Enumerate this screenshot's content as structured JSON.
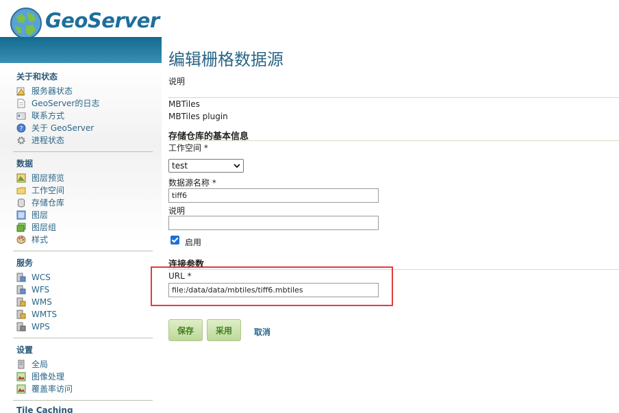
{
  "header": {
    "brand": "GeoServer"
  },
  "page": {
    "title": "编辑栅格数据源",
    "description_label": "说明",
    "type_name": "MBTiles",
    "type_description": "MBTiles plugin",
    "basic_info_heading": "存储仓库的基本信息",
    "workspace_label": "工作空间 *",
    "workspace_value": "test",
    "name_label": "数据源名称 *",
    "name_value": "tiff6",
    "desc_field_label": "说明",
    "desc_field_value": "",
    "enabled_label": "启用",
    "enabled": true,
    "connection_heading": "连接参数",
    "url_label": "URL *",
    "url_value": "file:/data/data/mbtiles/tiff6.mbtiles",
    "save_label": "保存",
    "apply_label": "采用",
    "cancel_label": "取消"
  },
  "sidebar": {
    "sections": [
      {
        "title": "关于和状态",
        "items": [
          "服务器状态",
          "GeoServer的日志",
          "联系方式",
          "关于 GeoServer",
          "进程状态"
        ]
      },
      {
        "title": "数据",
        "items": [
          "图层预览",
          "工作空间",
          "存储仓库",
          "图层",
          "图层组",
          "样式"
        ]
      },
      {
        "title": "服务",
        "items": [
          "WCS",
          "WFS",
          "WMS",
          "WMTS",
          "WPS"
        ]
      },
      {
        "title": "设置",
        "items": [
          "全局",
          "图像处理",
          "覆盖率访问"
        ]
      },
      {
        "title": "Tile Caching",
        "items": []
      }
    ]
  },
  "colors": {
    "accent": "#2a6688",
    "button_green": "#3f7d1f",
    "highlight": "#e23b3b",
    "band": "#13698f"
  }
}
